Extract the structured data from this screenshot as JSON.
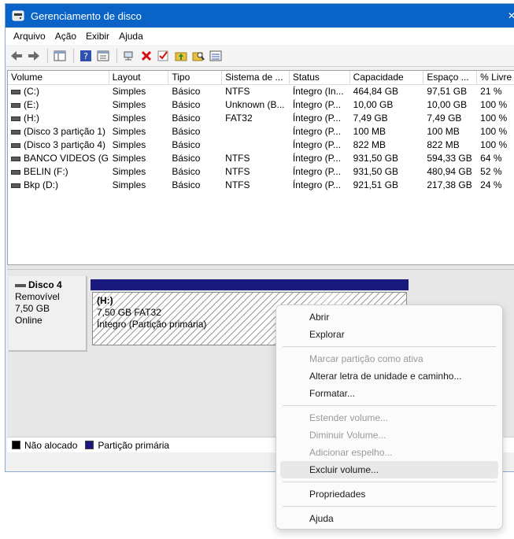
{
  "window": {
    "title": "Gerenciamento de disco",
    "close_glyph": "✕"
  },
  "menubar": {
    "items": [
      "Arquivo",
      "Ação",
      "Exibir",
      "Ajuda"
    ]
  },
  "toolbar": {
    "icons": [
      "back-arrow-icon",
      "forward-arrow-icon",
      "console-tree-icon",
      "help-icon",
      "properties-icon",
      "connect-icon",
      "delete-icon",
      "check-icon",
      "folder-up-icon",
      "search-folder-icon",
      "list-view-icon"
    ],
    "accent_colors": {
      "delete": "#d01010",
      "check": "#2a8a2a",
      "help": "#3050b0",
      "folder": "#e8c040"
    }
  },
  "volume_list": {
    "columns": [
      "Volume",
      "Layout",
      "Tipo",
      "Sistema de ...",
      "Status",
      "Capacidade",
      "Espaço ...",
      "% Livre"
    ],
    "rows": [
      [
        "(C:)",
        "Simples",
        "Básico",
        "NTFS",
        "Íntegro (In...",
        "464,84 GB",
        "97,51 GB",
        "21 %"
      ],
      [
        "(E:)",
        "Simples",
        "Básico",
        "Unknown (B...",
        "Íntegro (P...",
        "10,00 GB",
        "10,00 GB",
        "100 %"
      ],
      [
        "(H:)",
        "Simples",
        "Básico",
        "FAT32",
        "Íntegro (P...",
        "7,49 GB",
        "7,49 GB",
        "100 %"
      ],
      [
        "(Disco 3 partição 1)",
        "Simples",
        "Básico",
        "",
        "Íntegro (P...",
        "100 MB",
        "100 MB",
        "100 %"
      ],
      [
        "(Disco 3 partição 4)",
        "Simples",
        "Básico",
        "",
        "Íntegro (P...",
        "822 MB",
        "822 MB",
        "100 %"
      ],
      [
        "BANCO VIDEOS (G:)",
        "Simples",
        "Básico",
        "NTFS",
        "Íntegro (P...",
        "931,50 GB",
        "594,33 GB",
        "64 %"
      ],
      [
        "BELIN (F:)",
        "Simples",
        "Básico",
        "NTFS",
        "Íntegro (P...",
        "931,50 GB",
        "480,94 GB",
        "52 %"
      ],
      [
        "Bkp (D:)",
        "Simples",
        "Básico",
        "NTFS",
        "Íntegro (P...",
        "921,51 GB",
        "217,38 GB",
        "24 %"
      ]
    ]
  },
  "disk": {
    "name": "Disco 4",
    "type": "Removível",
    "size": "7,50 GB",
    "state": "Online",
    "partition": {
      "name": "(H:)",
      "size_fs": "7,50 GB FAT32",
      "status": "Íntegro (Partição primária)",
      "bar_color": "#1a1a7e"
    }
  },
  "legend": [
    {
      "label": "Não alocado",
      "color": "#000000"
    },
    {
      "label": "Partição primária",
      "color": "#1a1a7e"
    }
  ],
  "context_menu": {
    "items": [
      {
        "label": "Abrir",
        "enabled": true
      },
      {
        "label": "Explorar",
        "enabled": true
      },
      {
        "separator": true
      },
      {
        "label": "Marcar partição como ativa",
        "enabled": false
      },
      {
        "label": "Alterar letra de unidade e caminho...",
        "enabled": true
      },
      {
        "label": "Formatar...",
        "enabled": true
      },
      {
        "separator": true
      },
      {
        "label": "Estender volume...",
        "enabled": false
      },
      {
        "label": "Diminuir Volume...",
        "enabled": false
      },
      {
        "label": "Adicionar espelho...",
        "enabled": false
      },
      {
        "label": "Excluir volume...",
        "enabled": true,
        "highlighted": true
      },
      {
        "separator": true
      },
      {
        "label": "Propriedades",
        "enabled": true
      },
      {
        "separator": true
      },
      {
        "label": "Ajuda",
        "enabled": true
      }
    ]
  }
}
